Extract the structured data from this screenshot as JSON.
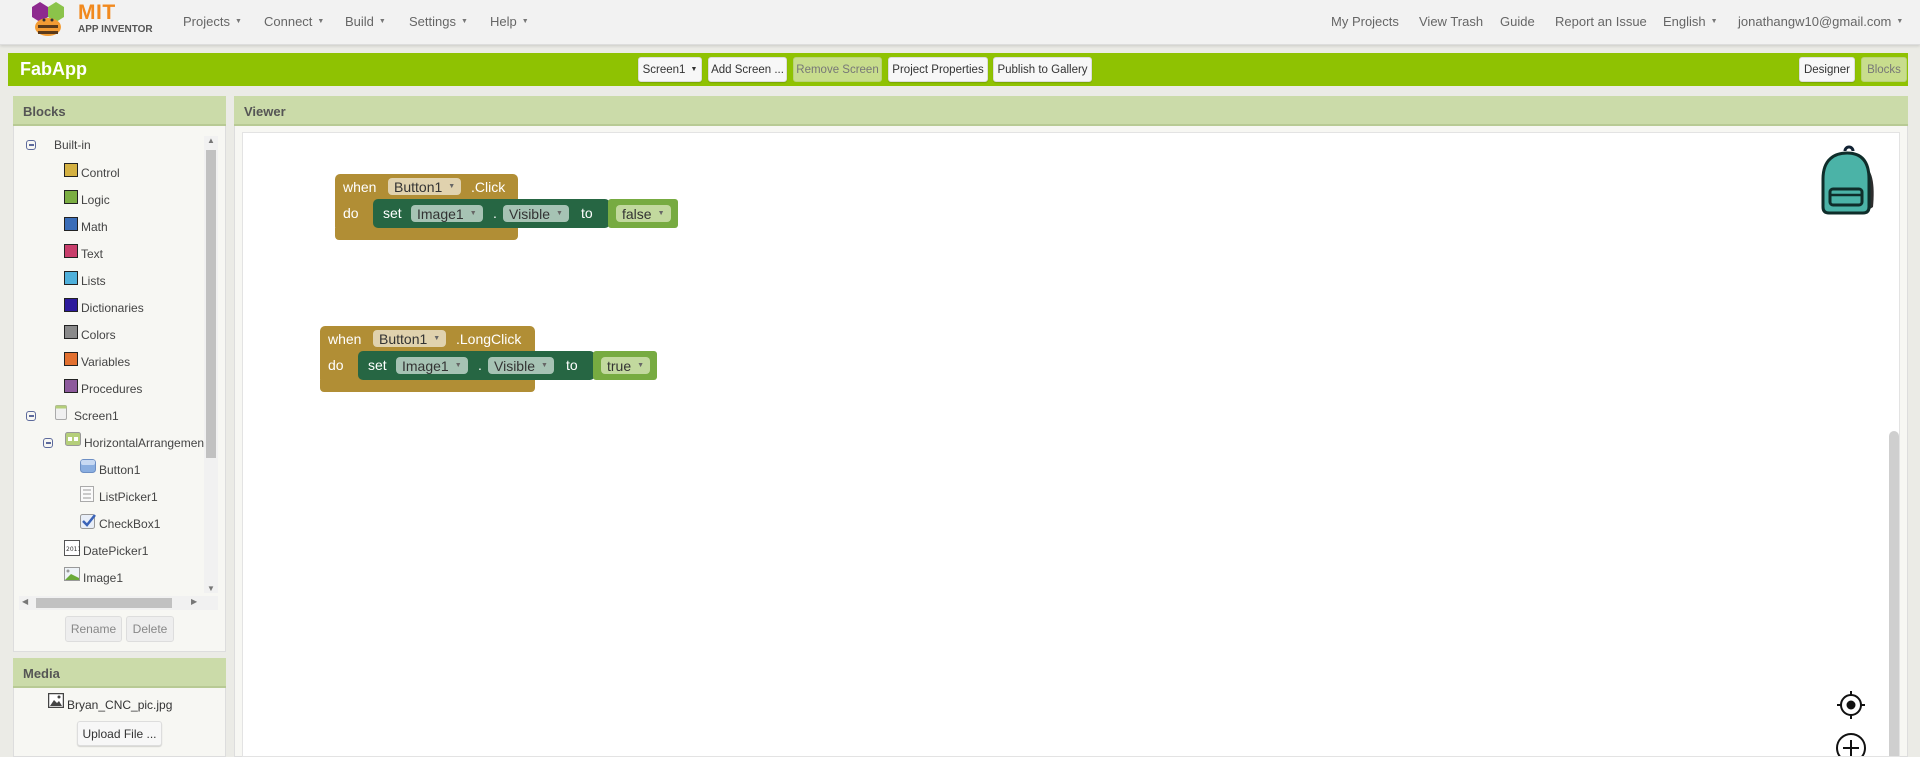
{
  "header": {
    "logo": {
      "line1": "MIT",
      "line2": "APP INVENTOR"
    },
    "menus": [
      {
        "label": "Projects"
      },
      {
        "label": "Connect"
      },
      {
        "label": "Build"
      },
      {
        "label": "Settings"
      },
      {
        "label": "Help"
      }
    ],
    "right_links": [
      {
        "label": "My Projects"
      },
      {
        "label": "View Trash"
      },
      {
        "label": "Guide"
      },
      {
        "label": "Report an Issue"
      }
    ],
    "language": "English",
    "account": "jonathangw10@gmail.com"
  },
  "toolbar": {
    "app_title": "FabApp",
    "screen_select": "Screen1",
    "add_screen": "Add Screen ...",
    "remove_screen": "Remove Screen",
    "project_properties": "Project Properties",
    "publish": "Publish to Gallery",
    "designer": "Designer",
    "blocks": "Blocks",
    "accent_color": "#8fc202"
  },
  "blocks_panel": {
    "title": "Blocks",
    "builtin_label": "Built-in",
    "builtin": [
      {
        "label": "Control",
        "color": "#d4b142"
      },
      {
        "label": "Logic",
        "color": "#7bae42"
      },
      {
        "label": "Math",
        "color": "#3a6db8"
      },
      {
        "label": "Text",
        "color": "#c83e6b"
      },
      {
        "label": "Lists",
        "color": "#4fb0db"
      },
      {
        "label": "Dictionaries",
        "color": "#2d1b9c"
      },
      {
        "label": "Colors",
        "color": "#8a8a8a"
      },
      {
        "label": "Variables",
        "color": "#e2702f"
      },
      {
        "label": "Procedures",
        "color": "#8d5a9c"
      }
    ],
    "screen": "Screen1",
    "components": [
      {
        "label": "HorizontalArrangemen",
        "icon": "horizontal-arrangement-icon",
        "level": 1
      },
      {
        "label": "Button1",
        "icon": "button-icon",
        "level": 2
      },
      {
        "label": "ListPicker1",
        "icon": "listpicker-icon",
        "level": 2
      },
      {
        "label": "CheckBox1",
        "icon": "checkbox-icon",
        "level": 2
      },
      {
        "label": "DatePicker1",
        "icon": "datepicker-icon",
        "level": 1
      },
      {
        "label": "Image1",
        "icon": "image-icon",
        "level": 1
      }
    ],
    "rename": "Rename",
    "delete": "Delete"
  },
  "media_panel": {
    "title": "Media",
    "files": [
      "Bryan_CNC_pic.jpg"
    ],
    "upload": "Upload File ..."
  },
  "viewer": {
    "title": "Viewer",
    "event_blocks": [
      {
        "when": "when",
        "component": "Button1",
        "event": ".Click",
        "do": "do",
        "set": "set",
        "target": "Image1",
        "dot": ".",
        "property": "Visible",
        "to": "to",
        "value": "false"
      },
      {
        "when": "when",
        "component": "Button1",
        "event": ".LongClick",
        "do": "do",
        "set": "set",
        "target": "Image1",
        "dot": ".",
        "property": "Visible",
        "to": "to",
        "value": "true"
      }
    ]
  }
}
